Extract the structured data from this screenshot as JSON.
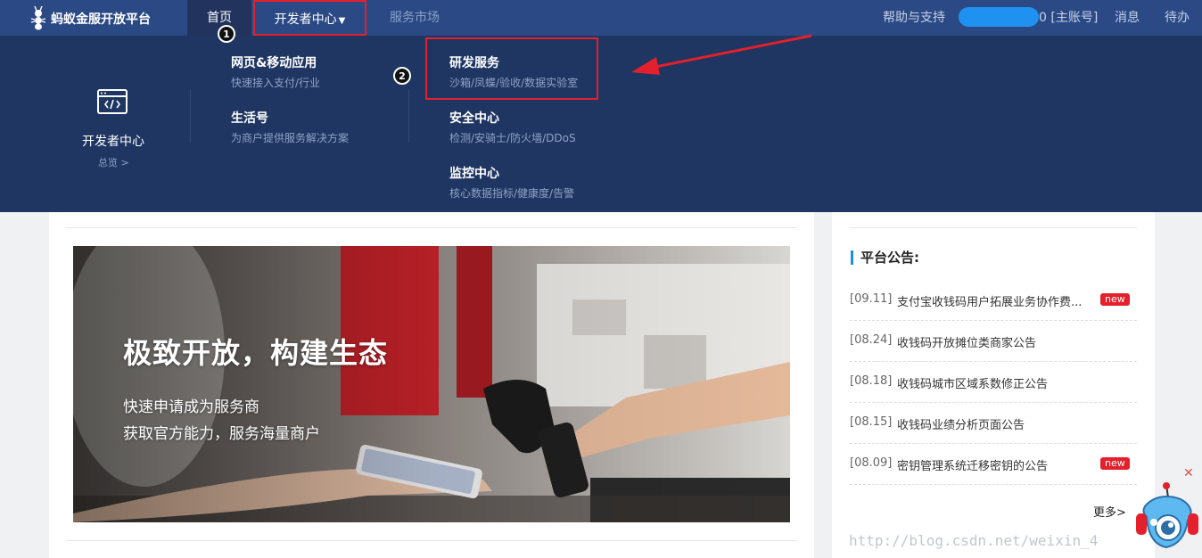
{
  "brand": {
    "name": "蚂蚁金服开放平台"
  },
  "nav": {
    "home": "首页",
    "developer_center": "开发者中心",
    "market": "服务市场",
    "help": "帮助与支持",
    "account_suffix": "0 [主账号]",
    "messages": "消息",
    "todo": "待办"
  },
  "mega_menu": {
    "overview_title": "开发者中心",
    "overview_link": "总览 >",
    "col1": [
      {
        "title": "网页&移动应用",
        "desc": "快速接入支付/行业"
      },
      {
        "title": "生活号",
        "desc": "为商户提供服务解决方案"
      }
    ],
    "col2": [
      {
        "title": "研发服务",
        "desc": "沙箱/凤蝶/验收/数据实验室"
      },
      {
        "title": "安全中心",
        "desc": "检测/安骑士/防火墙/DDoS"
      },
      {
        "title": "监控中心",
        "desc": "核心数据指标/健康度/告警"
      }
    ]
  },
  "annotations": {
    "step1": "1",
    "step2": "2"
  },
  "banner": {
    "title": "极致开放，构建生态",
    "line1": "快速申请成为服务商",
    "line2": "获取官方能力，服务海量商户"
  },
  "announcements": {
    "heading": "平台公告:",
    "items": [
      {
        "date": "[09.11]",
        "text": "支付宝收钱码用户拓展业务协作费...",
        "new": "new"
      },
      {
        "date": "[08.24]",
        "text": "收钱码开放摊位类商家公告"
      },
      {
        "date": "[08.18]",
        "text": "收钱码城市区域系数修正公告"
      },
      {
        "date": "[08.15]",
        "text": "收钱码业绩分析页面公告"
      },
      {
        "date": "[08.09]",
        "text": "密钥管理系统迁移密钥的公告",
        "new": "new"
      }
    ],
    "more": "更多>"
  },
  "watermark": "http://blog.csdn.net/weixin_4"
}
